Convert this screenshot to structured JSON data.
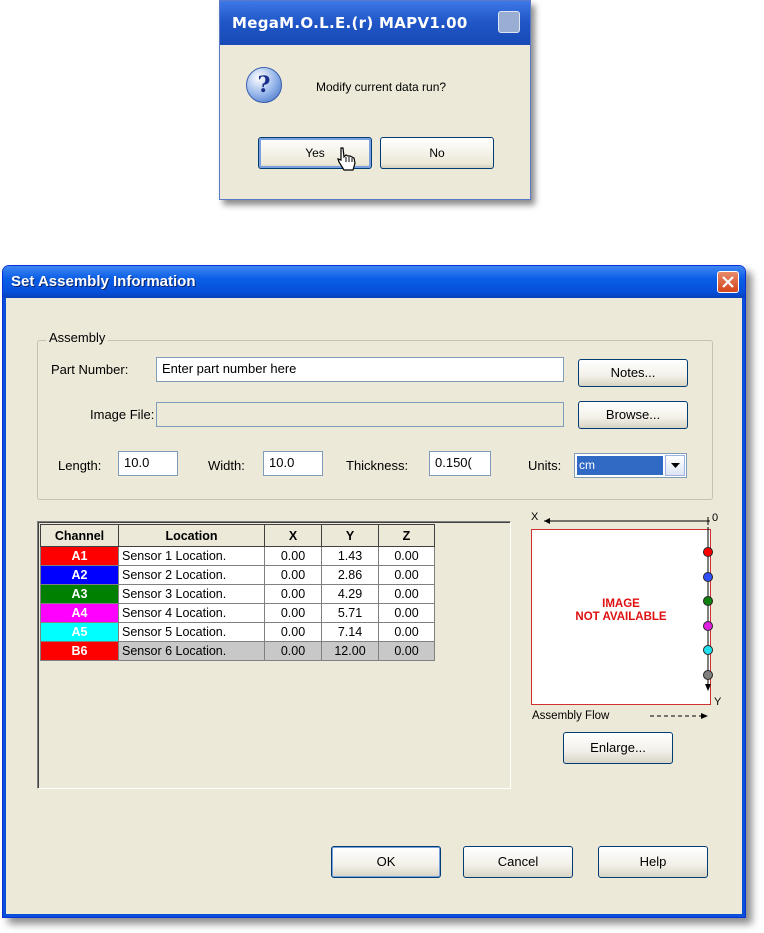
{
  "confirm_dialog": {
    "title": "MegaM.O.L.E.(r) MAPV1.00",
    "icon": "question-icon",
    "message": "Modify current data run?",
    "yes_label": "Yes",
    "no_label": "No"
  },
  "dialog": {
    "title": "Set Assembly Information",
    "assembly": {
      "legend": "Assembly",
      "part_number_label": "Part Number:",
      "part_number_value": "Enter part number here",
      "notes_label": "Notes...",
      "image_file_label": "Image File:",
      "image_file_value": "",
      "browse_label": "Browse...",
      "length_label": "Length:",
      "length_value": "10.0",
      "width_label": "Width:",
      "width_value": "10.0",
      "thickness_label": "Thickness:",
      "thickness_value": "0.150(",
      "units_label": "Units:",
      "units_value": "cm"
    },
    "table": {
      "columns": [
        "Channel",
        "Location",
        "X",
        "Y",
        "Z"
      ],
      "rows": [
        {
          "channel": "A1",
          "color": "#ff0000",
          "location": "Sensor 1 Location.",
          "x": "0.00",
          "y": "1.43",
          "z": "0.00"
        },
        {
          "channel": "A2",
          "color": "#0000ff",
          "location": "Sensor 2 Location.",
          "x": "0.00",
          "y": "2.86",
          "z": "0.00"
        },
        {
          "channel": "A3",
          "color": "#008000",
          "location": "Sensor 3 Location.",
          "x": "0.00",
          "y": "4.29",
          "z": "0.00"
        },
        {
          "channel": "A4",
          "color": "#ff00ff",
          "location": "Sensor 4 Location.",
          "x": "0.00",
          "y": "5.71",
          "z": "0.00"
        },
        {
          "channel": "A5",
          "color": "#00ffff",
          "location": "Sensor 5 Location.",
          "x": "0.00",
          "y": "7.14",
          "z": "0.00"
        },
        {
          "channel": "B6",
          "color": "#ff0000",
          "location": "Sensor 6 Location.",
          "x": "0.00",
          "y": "12.00",
          "z": "0.00"
        }
      ]
    },
    "preview": {
      "x_axis_label": "X",
      "zero_label": "0",
      "y_axis_label": "Y",
      "no_image_line1": "IMAGE",
      "no_image_line2": "NOT AVAILABLE",
      "flow_label": "Assembly Flow",
      "sensor_colors": [
        "#ff0000",
        "#3050ff",
        "#108010",
        "#e020e0",
        "#20e0f0",
        "#808080"
      ],
      "enlarge_label": "Enlarge..."
    },
    "ok_label": "OK",
    "cancel_label": "Cancel",
    "help_label": "Help"
  }
}
